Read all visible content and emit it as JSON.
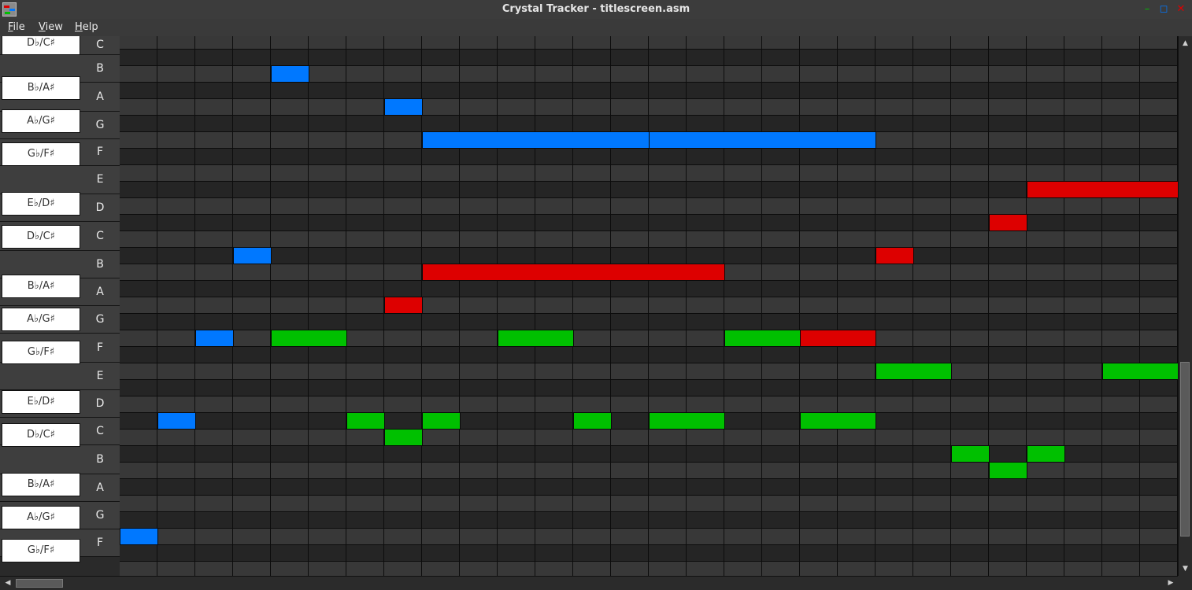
{
  "window": {
    "title": "Crystal Tracker - titlescreen.asm",
    "minimize_glyph": "–",
    "maximize_glyph": "◻",
    "close_glyph": "✕"
  },
  "menu": [
    {
      "label": "File",
      "mnemonic": "F",
      "rest": "ile"
    },
    {
      "label": "View",
      "mnemonic": "V",
      "rest": "iew"
    },
    {
      "label": "Help",
      "mnemonic": "H",
      "rest": "elp"
    }
  ],
  "keyboard": {
    "white_keys": [
      "C",
      "B",
      "A",
      "G",
      "F",
      "E",
      "D",
      "C",
      "B",
      "A",
      "G",
      "F",
      "E",
      "D",
      "C",
      "B",
      "A",
      "G",
      "F"
    ],
    "black_keys": [
      "D♭/C♯",
      "B♭/A♯",
      "A♭/G♯",
      "G♭/F♯",
      "E♭/D♯",
      "D♭/C♯",
      "B♭/A♯",
      "A♭/G♯",
      "G♭/F♯",
      "E♭/D♯",
      "D♭/C♯",
      "B♭/A♯",
      "A♭/G♯",
      "G♭/F♯"
    ]
  },
  "colors": {
    "channel_1": "#dd0000",
    "channel_2": "#00c000",
    "channel_3": "#0078ff"
  },
  "roll": {
    "columns_visible": 28,
    "rows_visible": 33,
    "notes": [
      {
        "channel": "channel_3",
        "row": 2,
        "start": 4,
        "length": 1
      },
      {
        "channel": "channel_3",
        "row": 4,
        "start": 7,
        "length": 1
      },
      {
        "channel": "channel_3",
        "row": 6,
        "start": 8,
        "length": 6
      },
      {
        "channel": "channel_3",
        "row": 6,
        "start": 14,
        "length": 6
      },
      {
        "channel": "channel_1",
        "row": 9,
        "start": 24,
        "length": 4
      },
      {
        "channel": "channel_1",
        "row": 11,
        "start": 23,
        "length": 1
      },
      {
        "channel": "channel_3",
        "row": 13,
        "start": 3,
        "length": 1
      },
      {
        "channel": "channel_1",
        "row": 13,
        "start": 20,
        "length": 1
      },
      {
        "channel": "channel_1",
        "row": 14,
        "start": 8,
        "length": 8
      },
      {
        "channel": "channel_1",
        "row": 16,
        "start": 7,
        "length": 1
      },
      {
        "channel": "channel_3",
        "row": 18,
        "start": 2,
        "length": 1
      },
      {
        "channel": "channel_2",
        "row": 18,
        "start": 4,
        "length": 2
      },
      {
        "channel": "channel_2",
        "row": 18,
        "start": 10,
        "length": 2
      },
      {
        "channel": "channel_2",
        "row": 18,
        "start": 16,
        "length": 2
      },
      {
        "channel": "channel_1",
        "row": 18,
        "start": 18,
        "length": 2
      },
      {
        "channel": "channel_2",
        "row": 20,
        "start": 20,
        "length": 2
      },
      {
        "channel": "channel_2",
        "row": 20,
        "start": 26,
        "length": 2
      },
      {
        "channel": "channel_3",
        "row": 23,
        "start": 1,
        "length": 1
      },
      {
        "channel": "channel_2",
        "row": 23,
        "start": 6,
        "length": 1
      },
      {
        "channel": "channel_2",
        "row": 23,
        "start": 8,
        "length": 1
      },
      {
        "channel": "channel_2",
        "row": 23,
        "start": 12,
        "length": 1
      },
      {
        "channel": "channel_2",
        "row": 23,
        "start": 14,
        "length": 2
      },
      {
        "channel": "channel_2",
        "row": 23,
        "start": 18,
        "length": 2
      },
      {
        "channel": "channel_2",
        "row": 24,
        "start": 7,
        "length": 1
      },
      {
        "channel": "channel_2",
        "row": 25,
        "start": 22,
        "length": 1
      },
      {
        "channel": "channel_2",
        "row": 25,
        "start": 24,
        "length": 1
      },
      {
        "channel": "channel_2",
        "row": 26,
        "start": 23,
        "length": 1
      },
      {
        "channel": "channel_3",
        "row": 30,
        "start": 0,
        "length": 1
      }
    ]
  },
  "scroll": {
    "up_glyph": "▲",
    "down_glyph": "▼",
    "left_glyph": "◀",
    "right_glyph": "▶",
    "vertical_position": 0.62,
    "horizontal_position": 0.0
  }
}
